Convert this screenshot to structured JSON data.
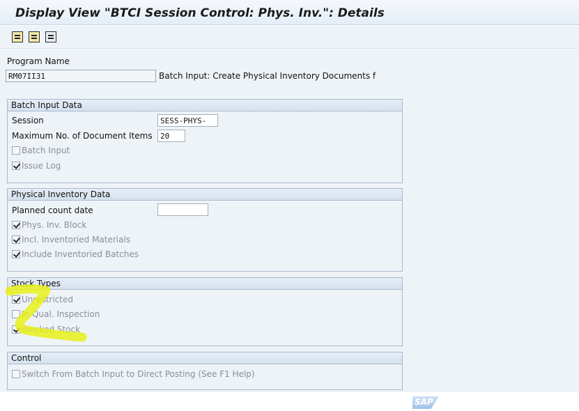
{
  "window": {
    "title": "Display View \"BTCI Session Control: Phys. Inv.\": Details"
  },
  "toolbar": {
    "buttons": [
      {
        "icon": "first-entry-icon"
      },
      {
        "icon": "next-entry-icon"
      },
      {
        "icon": "table-view-icon"
      }
    ]
  },
  "program": {
    "label": "Program Name",
    "value": "RM07II31",
    "description": "Batch Input: Create Physical Inventory Documents f"
  },
  "batch_input_data": {
    "title": "Batch Input Data",
    "session_label": "Session",
    "session_value": "SESS-PHYS-",
    "max_items_label": "Maximum No. of Document Items",
    "max_items_value": "20",
    "checkboxes": [
      {
        "label": "Batch Input",
        "checked": false
      },
      {
        "label": "Issue Log",
        "checked": true
      }
    ]
  },
  "physical_inventory_data": {
    "title": "Physical Inventory Data",
    "planned_count_label": "Planned count date",
    "planned_count_value": "",
    "checkboxes": [
      {
        "label": "Phys. Inv. Block",
        "checked": true
      },
      {
        "label": "Incl. Inventoried Materials",
        "checked": true
      },
      {
        "label": "Include Inventoried Batches",
        "checked": true
      }
    ]
  },
  "stock_types": {
    "title": "Stock Types",
    "checkboxes": [
      {
        "label": "Unrestricted",
        "checked": true
      },
      {
        "label": "In Qual. Inspection",
        "checked": false
      },
      {
        "label": "Blocked Stock",
        "checked": true
      }
    ]
  },
  "control": {
    "title": "Control",
    "checkboxes": [
      {
        "label": "Switch From Batch Input to Direct Posting (See F1 Help)",
        "checked": false
      }
    ]
  },
  "footer": {
    "logo_text": "SAP"
  },
  "colors": {
    "highlight": "#e8f01a",
    "group_header": "#d5e1ee",
    "background": "#eef3f8"
  }
}
